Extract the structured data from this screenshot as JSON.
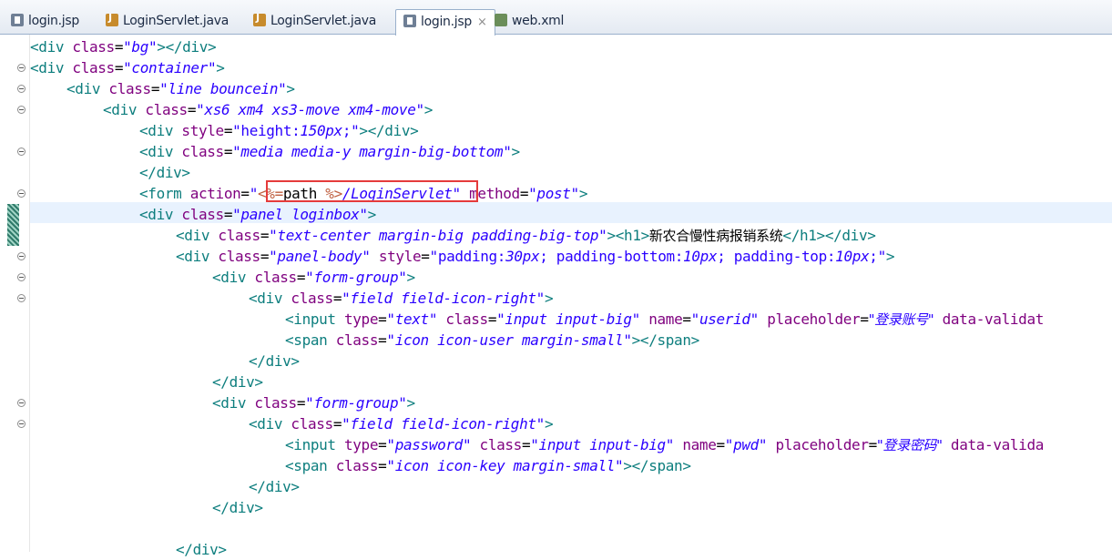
{
  "tabs": [
    {
      "label": "login.jsp",
      "icon": "jsp-file-icon"
    },
    {
      "label": "LoginServlet.java",
      "icon": "java-file-icon"
    },
    {
      "label": "LoginServlet.java",
      "icon": "java-file-icon"
    },
    {
      "label": "login.jsp",
      "icon": "jsp-file-icon",
      "active": true,
      "close": "×"
    },
    {
      "label": "web.xml",
      "icon": "xml-file-icon"
    }
  ],
  "code": {
    "l1": {
      "p1": "<div ",
      "p2": "class",
      "p3": "=",
      "p4": "\"bg\"",
      "p5": "></div>"
    },
    "l2": {
      "p1": "<div ",
      "p2": "class",
      "p3": "=",
      "p4": "\"container\"",
      "p5": ">"
    },
    "l3": {
      "p1": "<div ",
      "p2": "class",
      "p3": "=",
      "p4": "\"line bouncein\"",
      "p5": ">"
    },
    "l4": {
      "p1": "<div ",
      "p2": "class",
      "p3": "=",
      "p4": "\"xs6 xm4 xs3-move xm4-move\"",
      "p5": ">"
    },
    "l5": {
      "p1": "<div ",
      "p2": "style",
      "p3": "=",
      "p4": "\"height:",
      "p4b": "150px",
      "p4c": ";\"",
      "p5": "></div>"
    },
    "l6": {
      "p1": "<div ",
      "p2": "class",
      "p3": "=",
      "p4": "\"media media-y margin-big-bottom\"",
      "p5": ">"
    },
    "l7": {
      "p1": "</div>"
    },
    "l8": {
      "p1": "<form ",
      "p2": "action",
      "p3": "=",
      "p4": "\"",
      "j1": "<%=",
      "j2": "path ",
      "j3": "%>",
      "p4b": "/LoginServlet",
      "p4c": "\"",
      "p6": " method",
      "p7": "=",
      "p8": "\"post\"",
      "p5": ">"
    },
    "l9": {
      "p1": "<div ",
      "p2": "class",
      "p3": "=",
      "p4": "\"panel loginbox\"",
      "p5": ">"
    },
    "l10": {
      "p1": "<div ",
      "p2": "class",
      "p3": "=",
      "p4": "\"text-center margin-big padding-big-top\"",
      "p5": "><h1>",
      "txt": "新农合慢性病报销系统",
      "p6": "</h1></div>"
    },
    "l11": {
      "p1": "<div ",
      "p2": "class",
      "p3": "=",
      "p4": "\"panel-body\"",
      "p6": " style",
      "p7": "=",
      "p8": "\"padding:",
      "p8b": "30px",
      "p8c": "; padding-bottom:",
      "p8d": "10px",
      "p8e": "; padding-top:",
      "p8f": "10px",
      "p8g": ";\"",
      "p5": ">"
    },
    "l12": {
      "p1": "<div ",
      "p2": "class",
      "p3": "=",
      "p4": "\"form-group\"",
      "p5": ">"
    },
    "l13": {
      "p1": "<div ",
      "p2": "class",
      "p3": "=",
      "p4": "\"field field-icon-right\"",
      "p5": ">"
    },
    "l14": {
      "p1": "<input ",
      "p2": "type",
      "p3": "=",
      "p4": "\"text\"",
      "a2": " class",
      "a3": "=",
      "a4": "\"input input-big\"",
      "b2": " name",
      "b3": "=",
      "b4": "\"userid\"",
      "c2": " placeholder",
      "c3": "=",
      "c4": "\"登录账号\"",
      "d2": " data-validat"
    },
    "l15": {
      "p1": "<span ",
      "p2": "class",
      "p3": "=",
      "p4": "\"icon icon-user margin-small\"",
      "p5": "></span>"
    },
    "l16": {
      "p1": "</div>"
    },
    "l17": {
      "p1": "</div>"
    },
    "l18": {
      "p1": "<div ",
      "p2": "class",
      "p3": "=",
      "p4": "\"form-group\"",
      "p5": ">"
    },
    "l19": {
      "p1": "<div ",
      "p2": "class",
      "p3": "=",
      "p4": "\"field field-icon-right\"",
      "p5": ">"
    },
    "l20": {
      "p1": "<input ",
      "p2": "type",
      "p3": "=",
      "p4": "\"password\"",
      "a2": " class",
      "a3": "=",
      "a4": "\"input input-big\"",
      "b2": " name",
      "b3": "=",
      "b4": "\"pwd\"",
      "c2": " placeholder",
      "c3": "=",
      "c4": "\"登录密码\"",
      "d2": " data-valida"
    },
    "l21": {
      "p1": "<span ",
      "p2": "class",
      "p3": "=",
      "p4": "\"icon icon-key margin-small\"",
      "p5": "></span>"
    },
    "l22": {
      "p1": "</div>"
    },
    "l23": {
      "p1": "</div>"
    },
    "l25": {
      "p1": "</div>"
    }
  },
  "colors": {
    "tag": "#0d7e7e",
    "attribute": "#7f007f",
    "string": "#2a00ff",
    "jsp_delimiter": "#bf5f3f",
    "highlight_box": "#e53b3b",
    "current_line": "#e8f2fe"
  }
}
